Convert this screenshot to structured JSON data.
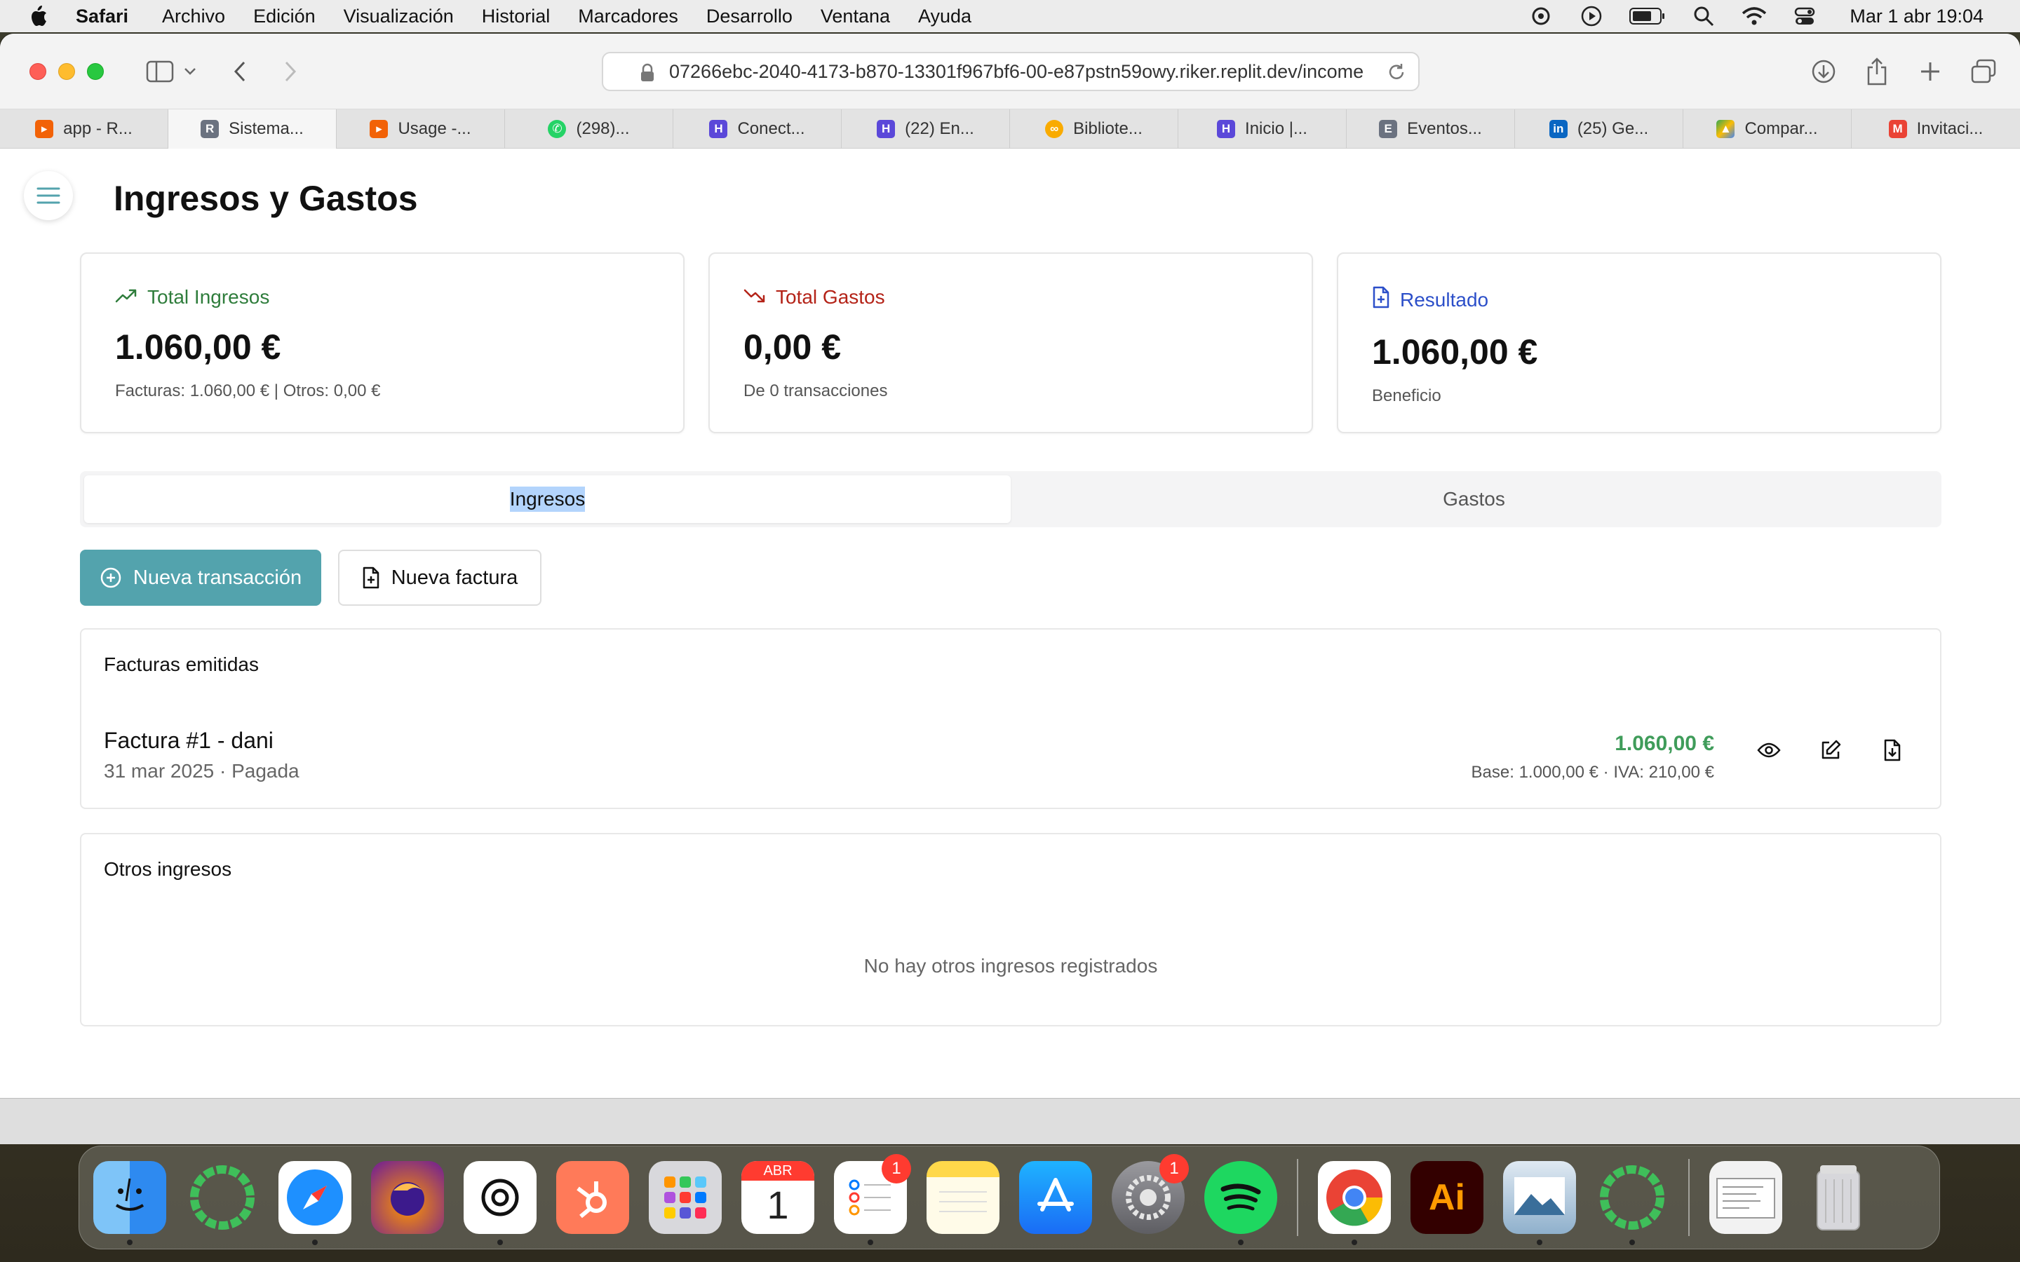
{
  "menubar": {
    "app_name": "Safari",
    "items": [
      "Archivo",
      "Edición",
      "Visualización",
      "Historial",
      "Marcadores",
      "Desarrollo",
      "Ventana",
      "Ayuda"
    ],
    "clock": "Mar 1 abr 19:04"
  },
  "browser": {
    "url": "07266ebc-2040-4173-b870-13301f967bf6-00-e87pstn59owy.riker.replit.dev/income",
    "tabs": [
      {
        "label": "app - R...",
        "icon": "replit-icon",
        "color": "#f26207"
      },
      {
        "label": "Sistema...",
        "icon": "r-letter-icon",
        "color": "#6b7280"
      },
      {
        "label": "Usage -...",
        "icon": "replit-icon",
        "color": "#f26207"
      },
      {
        "label": "(298)...",
        "icon": "whatsapp-icon",
        "color": "#25d366"
      },
      {
        "label": "Conect...",
        "icon": "h-logo-icon",
        "color": "#5b48d9"
      },
      {
        "label": "(22) En...",
        "icon": "h-logo-icon",
        "color": "#5b48d9"
      },
      {
        "label": "Bibliote...",
        "icon": "colab-icon",
        "color": "#f9ab00"
      },
      {
        "label": "Inicio |...",
        "icon": "h-logo-icon",
        "color": "#5b48d9"
      },
      {
        "label": "Eventos...",
        "icon": "e-letter-icon",
        "color": "#6b7280"
      },
      {
        "label": "(25) Ge...",
        "icon": "linkedin-icon",
        "color": "#0a66c2"
      },
      {
        "label": "Compar...",
        "icon": "google-drive-icon",
        "color": "#34a853"
      },
      {
        "label": "Invitaci...",
        "icon": "gmail-icon",
        "color": "#ea4335"
      }
    ]
  },
  "page": {
    "title": "Ingresos y Gastos",
    "cards": {
      "income": {
        "label": "Total Ingresos",
        "value": "1.060,00 €",
        "sub": "Facturas: 1.060,00 € | Otros: 0,00 €",
        "color": "#2f7d3c"
      },
      "expenses": {
        "label": "Total Gastos",
        "value": "0,00 €",
        "sub": "De 0 transacciones",
        "color": "#b42318"
      },
      "result": {
        "label": "Resultado",
        "value": "1.060,00 €",
        "sub": "Beneficio",
        "color": "#2c4fc9"
      }
    },
    "tabs": {
      "income": "Ingresos",
      "expenses": "Gastos",
      "selected": "Ingresos"
    },
    "buttons": {
      "new_transaction": "Nueva transacción",
      "new_invoice": "Nueva factura"
    },
    "invoices": {
      "title": "Facturas emitidas",
      "items": [
        {
          "name": "Factura #1 - dani",
          "meta": "31 mar 2025 · Pagada",
          "amount": "1.060,00 €",
          "detail": "Base: 1.000,00 € · IVA: 210,00 €"
        }
      ]
    },
    "other_income": {
      "title": "Otros ingresos",
      "empty": "No hay otros ingresos registrados"
    }
  },
  "dock": {
    "calendar_month": "ABR",
    "calendar_day": "1",
    "reminders_badge": "1",
    "settings_badge": "1",
    "illustrator_label": "Ai"
  },
  "colors": {
    "accent": "#53a3ad",
    "positive": "#3f9c5a"
  }
}
